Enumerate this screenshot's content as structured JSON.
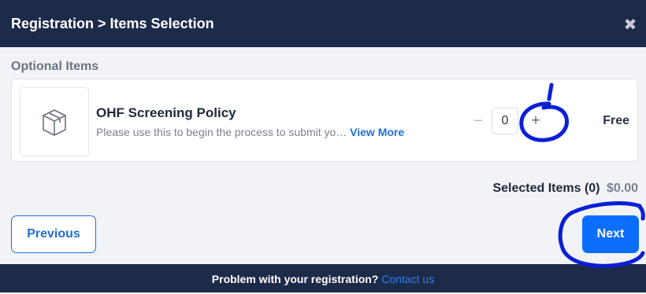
{
  "header": {
    "breadcrumb": "Registration > Items Selection",
    "close_icon": "close-icon"
  },
  "section": {
    "title": "Optional Items"
  },
  "item": {
    "name": "OHF Screening Policy",
    "description": "Please use this to begin the process to submit yo…",
    "view_more": "View More",
    "quantity": "0",
    "minus": "−",
    "plus": "+",
    "price": "Free",
    "icon": "box-icon"
  },
  "summary": {
    "label": "Selected Items (0)",
    "total": "$0.00"
  },
  "buttons": {
    "previous": "Previous",
    "next": "Next"
  },
  "footer": {
    "text": "Problem with your registration?",
    "link": "Contact us"
  },
  "colors": {
    "header_bg": "#1d2b4a",
    "primary": "#0d6efd",
    "link": "#1f6fd6",
    "annotation": "#0a1fd6"
  }
}
